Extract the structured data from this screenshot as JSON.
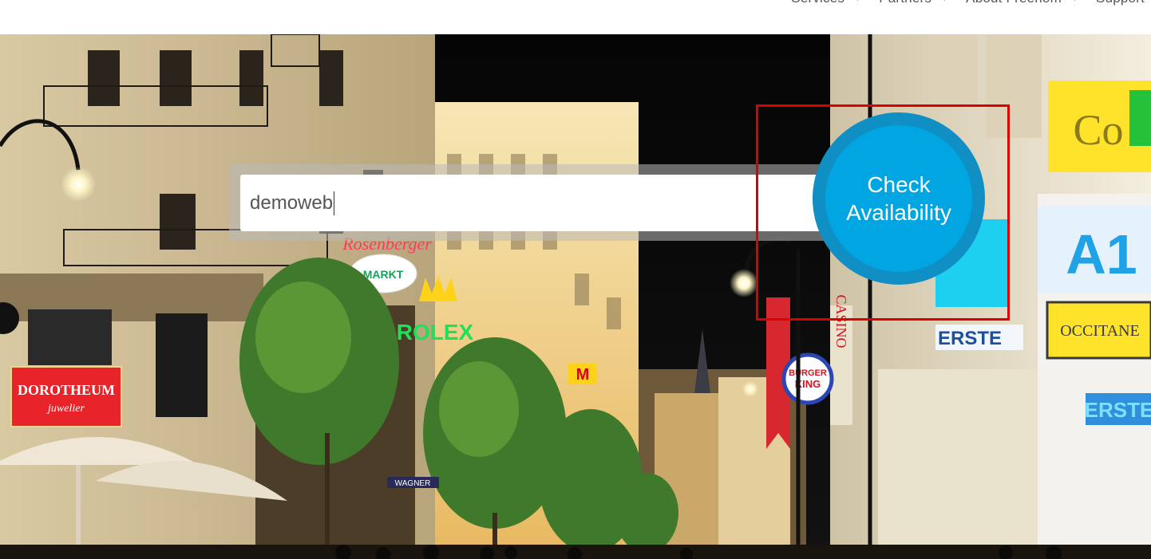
{
  "nav": {
    "items": [
      {
        "label": "Services",
        "icon": "chevron-down-icon"
      },
      {
        "label": "Partners",
        "icon": "chevron-down-icon"
      },
      {
        "label": "About Freenom",
        "icon": "chevron-down-icon"
      },
      {
        "label": "Support",
        "icon": null
      }
    ]
  },
  "search": {
    "value": "demoweb",
    "placeholder": ""
  },
  "check_button": {
    "label": "Check Availability"
  },
  "scene": {
    "signs": {
      "dorotheum": "DOROTHEUM",
      "juwelier": "juwelier",
      "rosenberger": "Rosenberger",
      "markt": "MARKT",
      "rolex": "ROLEX",
      "burger_king_top": "BURGER",
      "burger_king_bottom": "KING",
      "casino": "CASINO",
      "erste": "ERSTE",
      "erste_right": "ERSTE",
      "occitane": "OCCITANE",
      "wagner": "WAGNER",
      "co": "Co",
      "a1": "A1"
    }
  },
  "colors": {
    "accent_blue": "#00a5e1",
    "accent_blue_ring": "#0f8fc4",
    "highlight_red": "#dd0000"
  }
}
